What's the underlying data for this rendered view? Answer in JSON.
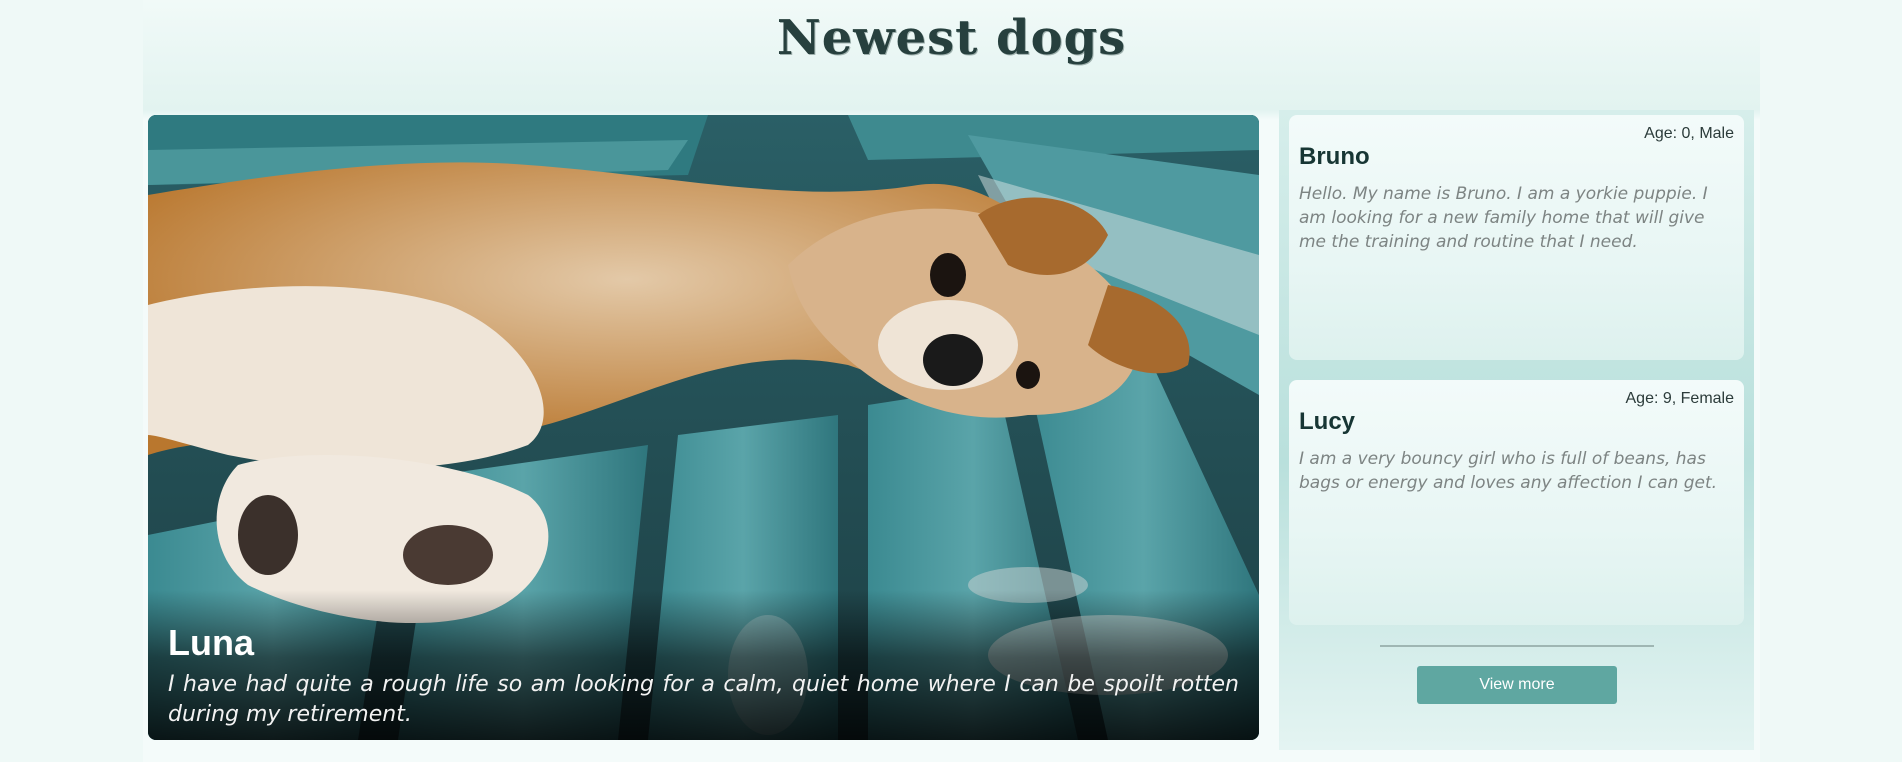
{
  "section": {
    "title": "Newest dogs"
  },
  "featured": {
    "name": "Luna",
    "description": "I have had quite a rough life so am looking for a calm, quiet home where I can be spoilt rotten during my retirement."
  },
  "cards": [
    {
      "name": "Bruno",
      "meta": "Age: 0, Male",
      "description": "Hello. My name is Bruno. I am a yorkie puppie. I am looking for a new family home that will give me the training and routine that I need."
    },
    {
      "name": "Lucy",
      "meta": "Age: 9, Female",
      "description": "I am a very bouncy girl who is full of beans, has bags or energy and loves any affection I can get."
    }
  ],
  "actions": {
    "view_more_label": "View more"
  },
  "colors": {
    "accent": "#5fa7a1",
    "background": "#eff9f7"
  }
}
